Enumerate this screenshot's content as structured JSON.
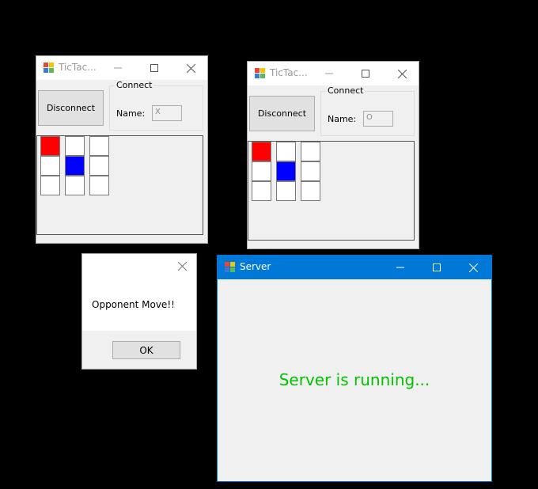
{
  "client_x": {
    "title": "TicTac...",
    "connect_button": "Disconnect",
    "group_label": "Connect",
    "name_label": "Name:",
    "name_value": "X",
    "board": [
      "red",
      "white",
      "white",
      "white",
      "blue",
      "white",
      "white",
      "white",
      "white"
    ]
  },
  "client_o": {
    "title": "TicTac...",
    "connect_button": "Disconnect",
    "group_label": "Connect",
    "name_label": "Name:",
    "name_value": "O",
    "board": [
      "red",
      "white",
      "white",
      "white",
      "blue",
      "white",
      "white",
      "white",
      "white"
    ]
  },
  "dialog": {
    "message": "Opponent Move!!",
    "ok_label": "OK"
  },
  "server": {
    "title": "Server",
    "status": "Server is running..."
  },
  "colors": {
    "red": "#ff0000",
    "blue": "#0000ff",
    "white": "#ffffff",
    "server_titlebar": "#0078d7",
    "status_text": "#00c000"
  }
}
